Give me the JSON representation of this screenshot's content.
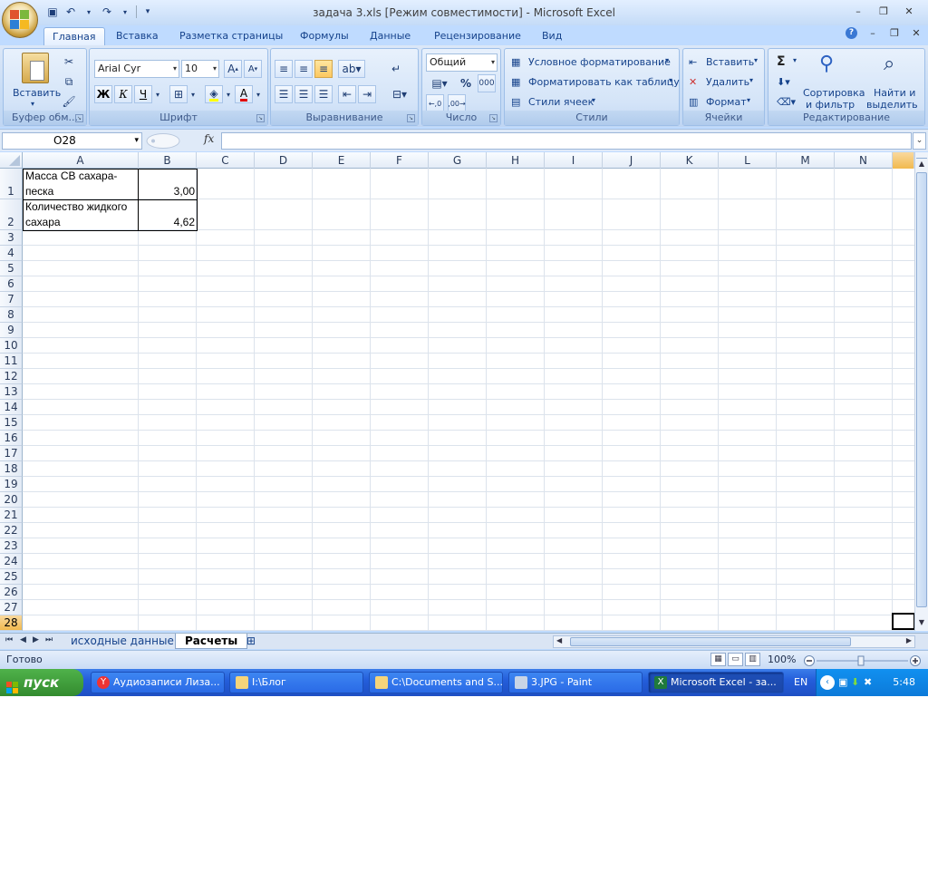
{
  "window": {
    "title": "задача 3.xls  [Режим совместимости] - Microsoft Excel",
    "minimize": "–",
    "restore": "❐",
    "close": "✕"
  },
  "tabs": [
    "Главная",
    "Вставка",
    "Разметка страницы",
    "Формулы",
    "Данные",
    "Рецензирование",
    "Вид"
  ],
  "ribbon_controls": {
    "help": "?",
    "minimize": "–",
    "restore": "❐",
    "close": "✕"
  },
  "ribbon": {
    "clipboard": {
      "caption": "Буфер обм...",
      "paste": "Вставить"
    },
    "font": {
      "caption": "Шрифт",
      "font_name": "Arial Cyr",
      "font_size": "10",
      "bold": "Ж",
      "italic": "К",
      "underline": "Ч"
    },
    "alignment": {
      "caption": "Выравнивание"
    },
    "number": {
      "caption": "Число",
      "format": "Общий",
      "percent": "%",
      "thousands": "000"
    },
    "styles": {
      "caption": "Стили",
      "conditional": "Условное форматирование",
      "format_table": "Форматировать как таблицу",
      "cell_styles": "Стили ячеек"
    },
    "cells": {
      "caption": "Ячейки",
      "insert": "Вставить",
      "delete": "Удалить",
      "format": "Формат"
    },
    "editing": {
      "caption": "Редактирование",
      "sort_line1": "Сортировка",
      "sort_line2": "и фильтр",
      "find_line1": "Найти и",
      "find_line2": "выделить",
      "sigma": "Σ"
    }
  },
  "formula_bar": {
    "name_box": "O28",
    "fx": "fx",
    "formula": ""
  },
  "columns": [
    "A",
    "B",
    "C",
    "D",
    "E",
    "F",
    "G",
    "H",
    "I",
    "J",
    "K",
    "L",
    "M",
    "N"
  ],
  "rows": [
    "1",
    "2",
    "3",
    "4",
    "5",
    "6",
    "7",
    "8",
    "9",
    "10",
    "11",
    "12",
    "13",
    "14",
    "15",
    "16",
    "17",
    "18",
    "19",
    "20",
    "21",
    "22",
    "23",
    "24",
    "25",
    "26",
    "27",
    "28"
  ],
  "cells": {
    "a1_line1": "Масса СВ сахара-",
    "a1_line2": "песка",
    "b1": "3,00",
    "a2_line1": "Количество жидкого",
    "a2_line2": "сахара",
    "b2": "4,62"
  },
  "sheets": [
    "исходные данные",
    "Расчеты"
  ],
  "status": {
    "ready": "Готово",
    "zoom": "100%"
  },
  "taskbar": {
    "start": "пуск",
    "items": [
      "Аудиозаписи Лиза...",
      "I:\\Блог",
      "C:\\Documents and S...",
      "3.JPG - Paint",
      "Microsoft Excel - за..."
    ],
    "lang": "EN",
    "clock": "5:48"
  }
}
